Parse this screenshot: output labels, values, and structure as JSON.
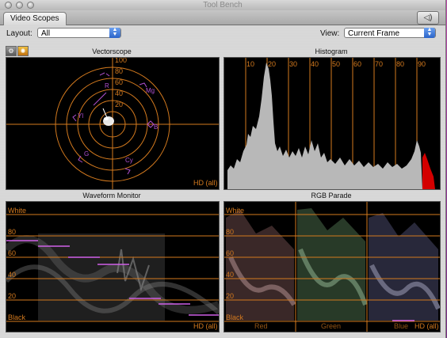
{
  "window": {
    "title": "Tool Bench"
  },
  "tabs": [
    {
      "label": "Video Scopes"
    }
  ],
  "controls": {
    "layout_label": "Layout:",
    "layout_value": "All",
    "view_label": "View:",
    "view_value": "Current Frame"
  },
  "panels": {
    "vectorscope": {
      "title": "Vectorscope",
      "rings": [
        "100",
        "80",
        "60",
        "40",
        "20"
      ],
      "targets": [
        "R",
        "Mg",
        "B",
        "Cy",
        "G",
        "Yl"
      ],
      "footer": "HD (all)"
    },
    "histogram": {
      "title": "Histogram",
      "ticks": [
        "10",
        "20",
        "30",
        "40",
        "50",
        "60",
        "70",
        "80",
        "90"
      ]
    },
    "waveform": {
      "title": "Waveform Monitor",
      "levels": [
        "White",
        "80",
        "60",
        "40",
        "20",
        "Black"
      ],
      "footer": "HD (all)"
    },
    "parade": {
      "title": "RGB Parade",
      "levels": [
        "White",
        "80",
        "60",
        "40",
        "20",
        "Black"
      ],
      "channels": [
        "Red",
        "Green",
        "Blue"
      ],
      "footer": "HD (all)"
    }
  },
  "colors": {
    "scale": "#d47a1e",
    "clip": "#d40000",
    "overlay": "#c060e0"
  }
}
